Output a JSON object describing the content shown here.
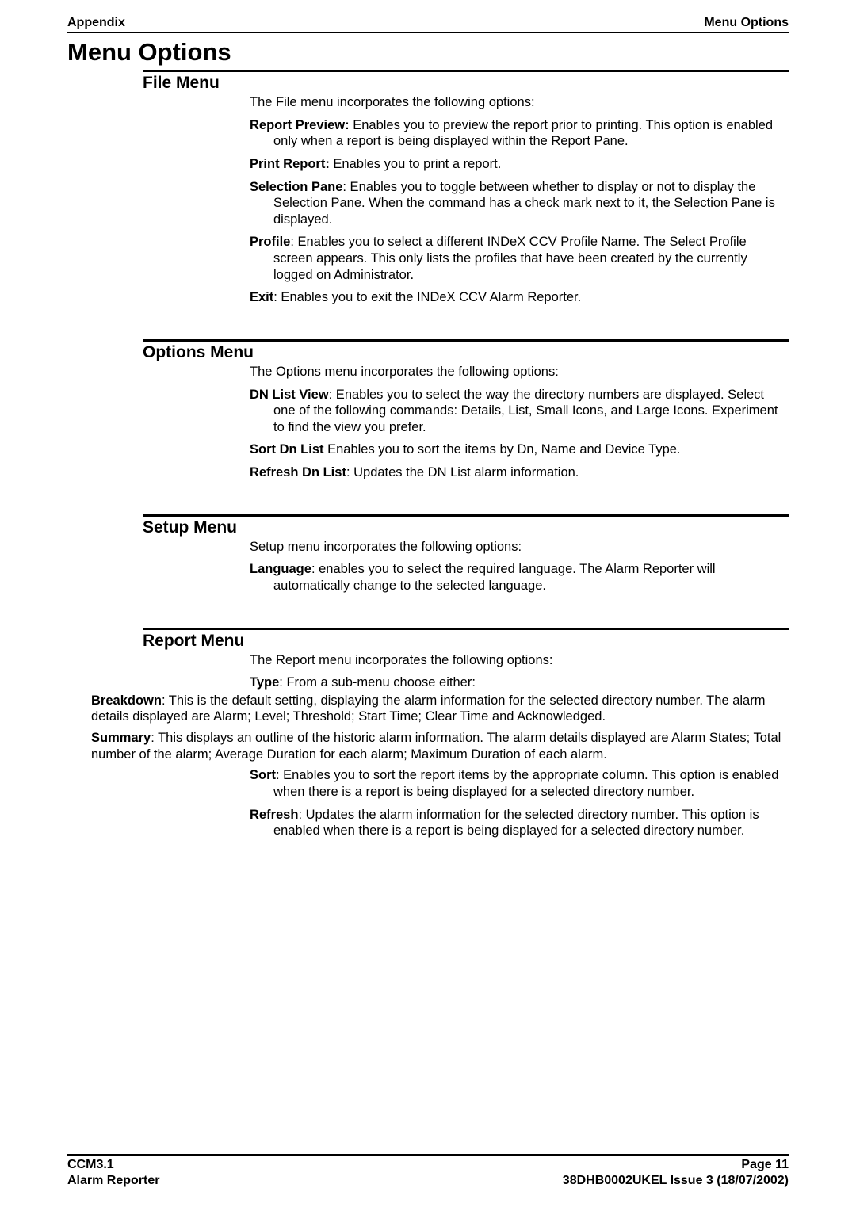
{
  "header": {
    "left": "Appendix",
    "right": "Menu Options"
  },
  "main_title": "Menu Options",
  "sections": [
    {
      "title": "File Menu",
      "intro": "The File menu incorporates the following options:",
      "items": [
        {
          "label": "Report Preview:",
          "text": " Enables you to preview the report prior to printing.  This option is enabled only when a report is being displayed within the Report Pane."
        },
        {
          "label": "Print Report:",
          "text": " Enables you to print a report."
        },
        {
          "label": "Selection Pane",
          "text": ": Enables you to toggle between whether to display or not to display the Selection Pane.  When the command has a check mark next to it, the Selection Pane is displayed."
        },
        {
          "label": "Profile",
          "text": ": Enables you to select a different INDeX CCV Profile Name.  The Select Profile screen appears.  This only lists the profiles that have been created by the currently logged on Administrator."
        },
        {
          "label": "Exit",
          "text": ": Enables you to exit the INDeX CCV Alarm Reporter."
        }
      ]
    },
    {
      "title": "Options Menu",
      "intro": "The Options menu incorporates the following options:",
      "items": [
        {
          "label": "DN List View",
          "text": ": Enables you to select the way the directory numbers are displayed.  Select one of the following commands: Details, List, Small Icons, and Large Icons.  Experiment to find the view you prefer."
        },
        {
          "label": "Sort Dn List",
          "text": " Enables you to sort the items by Dn, Name and Device Type."
        },
        {
          "label": "Refresh Dn List",
          "text": ": Updates the DN List alarm information."
        }
      ]
    },
    {
      "title": "Setup Menu",
      "intro": "Setup menu incorporates the following options:",
      "items": [
        {
          "label": "Language",
          "text": ": enables you to select the required language.  The Alarm Reporter will automatically change to the selected language."
        }
      ]
    },
    {
      "title": "Report Menu",
      "intro": "The Report menu incorporates the following options:",
      "items_complex": true,
      "type_label": "Type",
      "type_text": ": From a sub-menu choose either:",
      "breakdown_label": "Breakdown",
      "breakdown_text": ": This is the default setting, displaying the alarm information for the selected directory number.  The alarm details displayed are Alarm; Level; Threshold; Start Time; Clear Time and Acknowledged.",
      "summary_label": "Summary",
      "summary_text": ": This displays an outline of the historic alarm information.  The alarm details displayed are Alarm States; Total number of the alarm; Average Duration for each alarm; Maximum Duration of each alarm.",
      "sort_label": "Sort",
      "sort_text": ": Enables you to sort the report items by the appropriate column.  This option is enabled when there is a report is being displayed for a selected directory number.",
      "refresh_label": "Refresh",
      "refresh_text": ": Updates the alarm information for the selected directory number.  This option is enabled when there is a report is being displayed for a selected directory number."
    }
  ],
  "footer": {
    "left1": "CCM3.1",
    "left2": "Alarm Reporter",
    "right1": "Page 11",
    "right2": "38DHB0002UKEL Issue 3 (18/07/2002)"
  }
}
